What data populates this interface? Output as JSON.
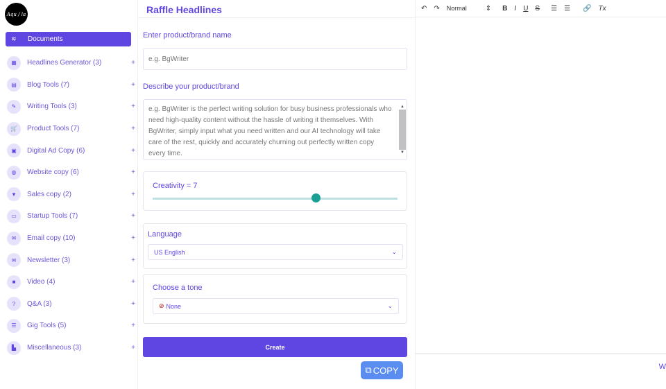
{
  "logo_text": "Aqu / la",
  "sidebar": {
    "documents": "Documents",
    "items": [
      {
        "label": "Headlines Generator (3)",
        "icon": "▦"
      },
      {
        "label": "Blog Tools (7)",
        "icon": "▤"
      },
      {
        "label": "Writing Tools (3)",
        "icon": "✎"
      },
      {
        "label": "Product Tools (7)",
        "icon": "🛒"
      },
      {
        "label": "Digital Ad Copy (6)",
        "icon": "▣"
      },
      {
        "label": "Website copy (6)",
        "icon": "◍"
      },
      {
        "label": "Sales copy (2)",
        "icon": "▼"
      },
      {
        "label": "Startup Tools (7)",
        "icon": "▭"
      },
      {
        "label": "Email copy (10)",
        "icon": "✉"
      },
      {
        "label": "Newsletter (3)",
        "icon": "✉"
      },
      {
        "label": "Video (4)",
        "icon": "■"
      },
      {
        "label": "Q&A (3)",
        "icon": "?"
      },
      {
        "label": "Gig Tools (5)",
        "icon": "☰"
      },
      {
        "label": "Miscellaneous (3)",
        "icon": "▙"
      }
    ],
    "plus": "+"
  },
  "main": {
    "title": "Raffle Headlines",
    "name_label": "Enter product/brand name",
    "name_placeholder": "e.g. BgWriter",
    "desc_label": "Describe your product/brand",
    "desc_placeholder": "e.g. BgWriter is the perfect writing solution for busy business professionals who need high-quality content without the hassle of writing it themselves. With BgWriter, simply input what you need written and our AI technology will take care of the rest, quickly and accurately churning out perfectly written copy every time.",
    "creativity_label": "Creativity = 7",
    "creativity_value": 7,
    "creativity_min": 1,
    "creativity_max": 10,
    "language_label": "Language",
    "language_value": "US English",
    "tone_label": "Choose a tone",
    "tone_value": "None",
    "create": "Create",
    "copy": "COPY"
  },
  "editor": {
    "format": "Normal",
    "footer_char": "W"
  },
  "colors": {
    "accent": "#5f45e2",
    "slider": "#1a9f94",
    "copy": "#5b8df0"
  }
}
